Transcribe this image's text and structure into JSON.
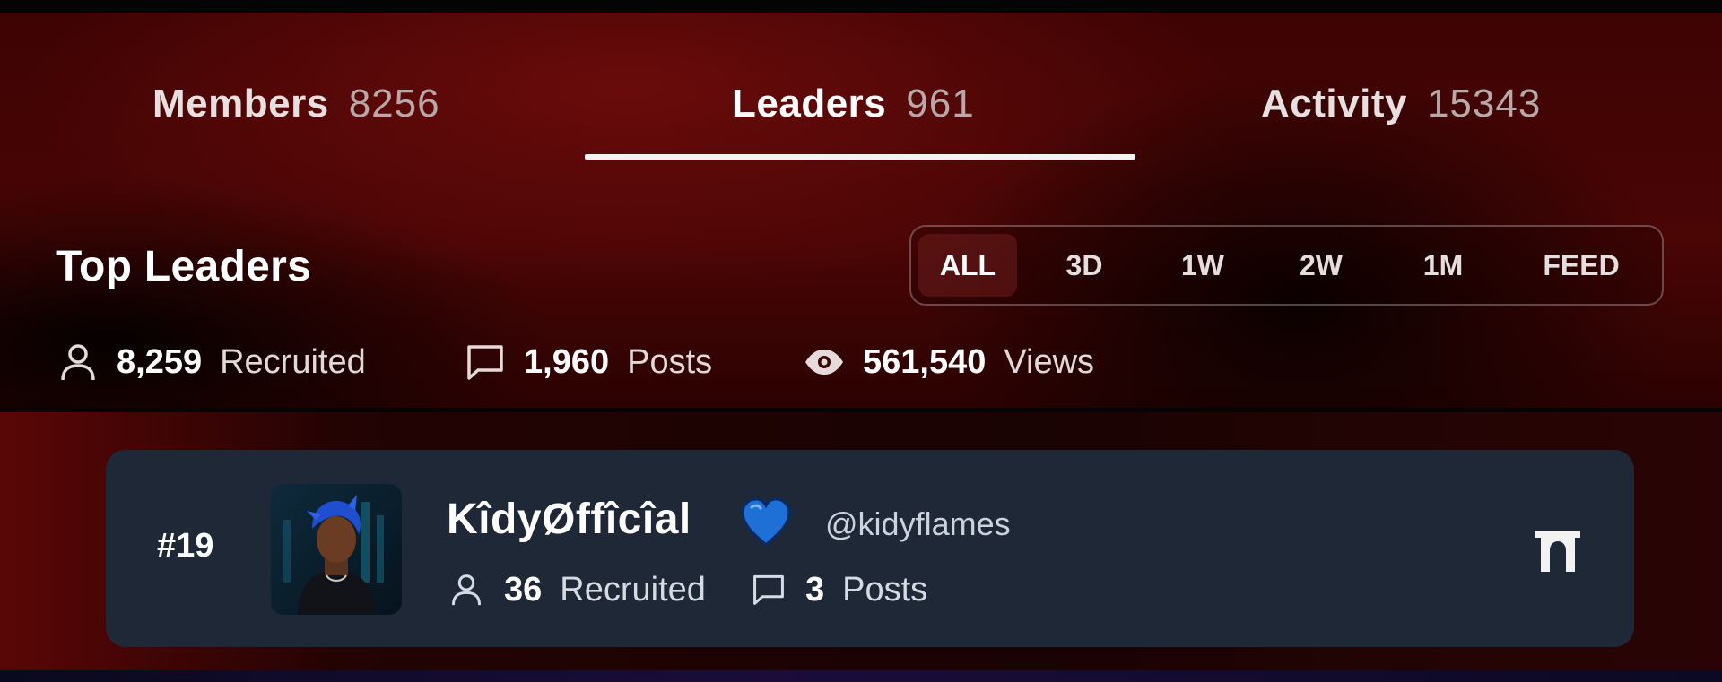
{
  "tabs": [
    {
      "label": "Members",
      "count": "8256"
    },
    {
      "label": "Leaders",
      "count": "961"
    },
    {
      "label": "Activity",
      "count": "15343"
    }
  ],
  "section_title": "Top Leaders",
  "filters": [
    {
      "label": "ALL"
    },
    {
      "label": "3D"
    },
    {
      "label": "1W"
    },
    {
      "label": "2W"
    },
    {
      "label": "1M"
    },
    {
      "label": "FEED"
    }
  ],
  "summary": {
    "recruited": {
      "value": "8,259",
      "label": "Recruited",
      "icon": "person-icon"
    },
    "posts": {
      "value": "1,960",
      "label": "Posts",
      "icon": "chat-bubble-icon"
    },
    "views": {
      "value": "561,540",
      "label": "Views",
      "icon": "eye-icon"
    }
  },
  "leader": {
    "rank": "#19",
    "name": "KîdyØffîcîal",
    "badge_icon": "blue-heart-icon",
    "handle": "@kidyflames",
    "recruited": {
      "value": "36",
      "label": "Recruited"
    },
    "posts": {
      "value": "3",
      "label": "Posts"
    },
    "action_icon": "gate-icon"
  },
  "colors": {
    "background_red": "#4a0505",
    "card": "#1e2837",
    "heart_blue": "#1e6fd6",
    "text": "#ffffff"
  }
}
